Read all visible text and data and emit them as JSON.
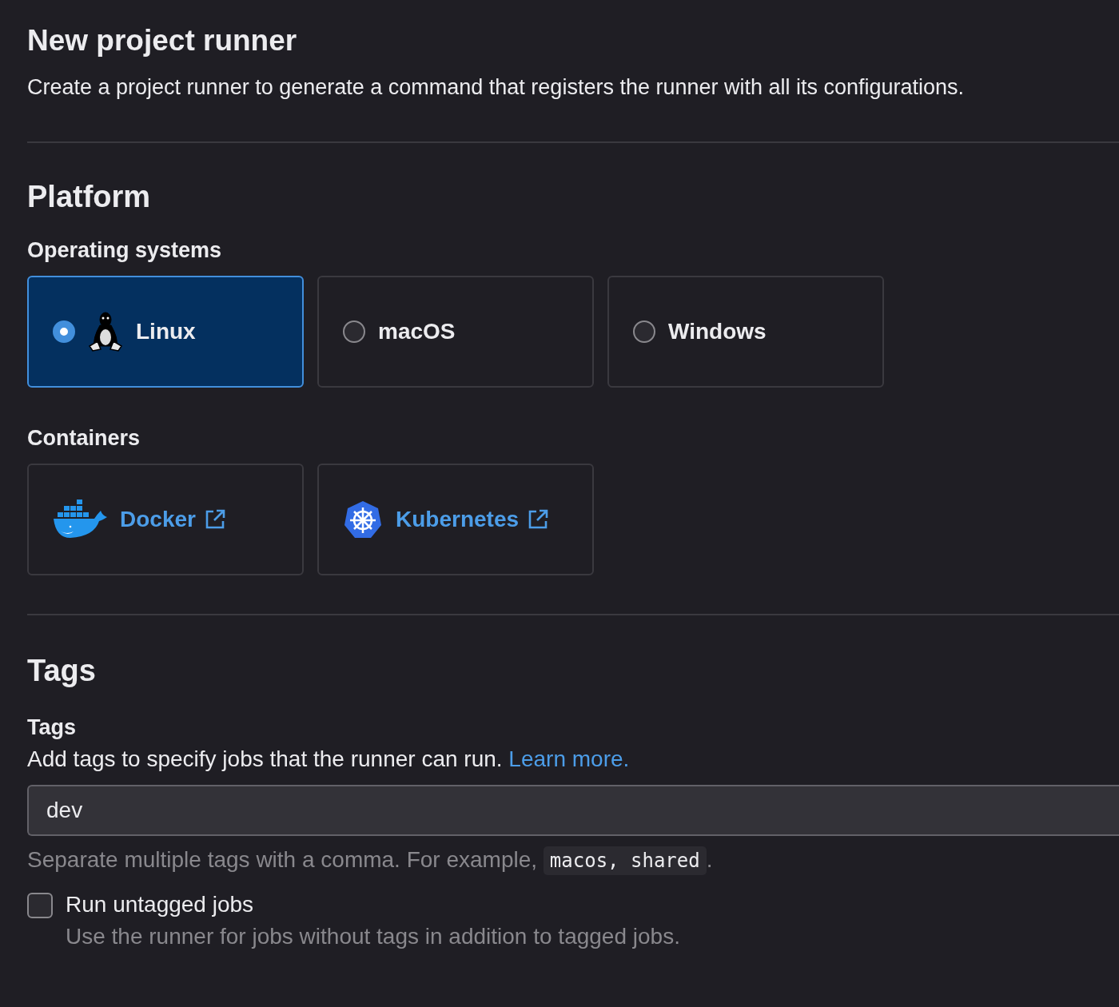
{
  "page": {
    "title": "New project runner",
    "description": "Create a project runner to generate a command that registers the runner with all its configurations."
  },
  "platform": {
    "heading": "Platform",
    "operating_systems": {
      "label": "Operating systems",
      "options": [
        {
          "label": "Linux",
          "selected": true,
          "kind": "linux"
        },
        {
          "label": "macOS",
          "selected": false,
          "kind": "plain"
        },
        {
          "label": "Windows",
          "selected": false,
          "kind": "plain"
        }
      ]
    },
    "containers": {
      "label": "Containers",
      "links": [
        {
          "label": "Docker",
          "kind": "docker"
        },
        {
          "label": "Kubernetes",
          "kind": "kubernetes"
        }
      ]
    }
  },
  "tags": {
    "heading": "Tags",
    "field_label": "Tags",
    "description": "Add tags to specify jobs that the runner can run.",
    "learn_more": "Learn more.",
    "value": "dev",
    "help": {
      "before": "Separate multiple tags with a comma. For example,",
      "code": "macos, shared",
      "after": "."
    },
    "untagged": {
      "label": "Run untagged jobs",
      "checked": false,
      "help": "Use the runner for jobs without tags in addition to tagged jobs."
    }
  }
}
